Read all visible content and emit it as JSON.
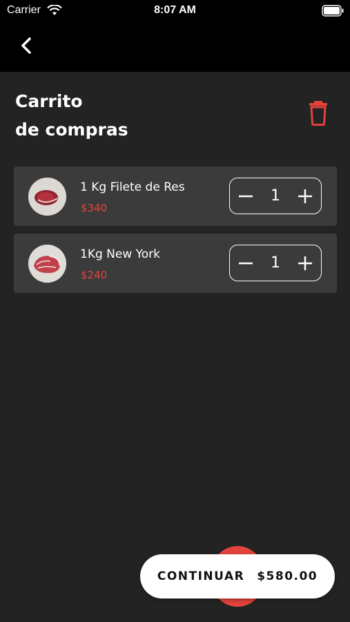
{
  "status_bar": {
    "carrier": "Carrier",
    "time": "8:07 AM"
  },
  "nav": {
    "back_icon": "chevron-left-icon"
  },
  "header": {
    "title_line1": "Carrito",
    "title_line2": "de compras",
    "clear_icon": "trash-icon"
  },
  "cart": {
    "items": [
      {
        "name": "1 Kg Filete de Res",
        "price": "$340",
        "quantity": "1"
      },
      {
        "name": "1Kg New York",
        "price": "$240",
        "quantity": "1"
      }
    ]
  },
  "footer": {
    "continue_label": "CONTINUAR",
    "total": "$580.00"
  },
  "colors": {
    "accent": "#e4433c",
    "background": "#232323",
    "card": "#3b3b3b",
    "bar": "#000000"
  }
}
